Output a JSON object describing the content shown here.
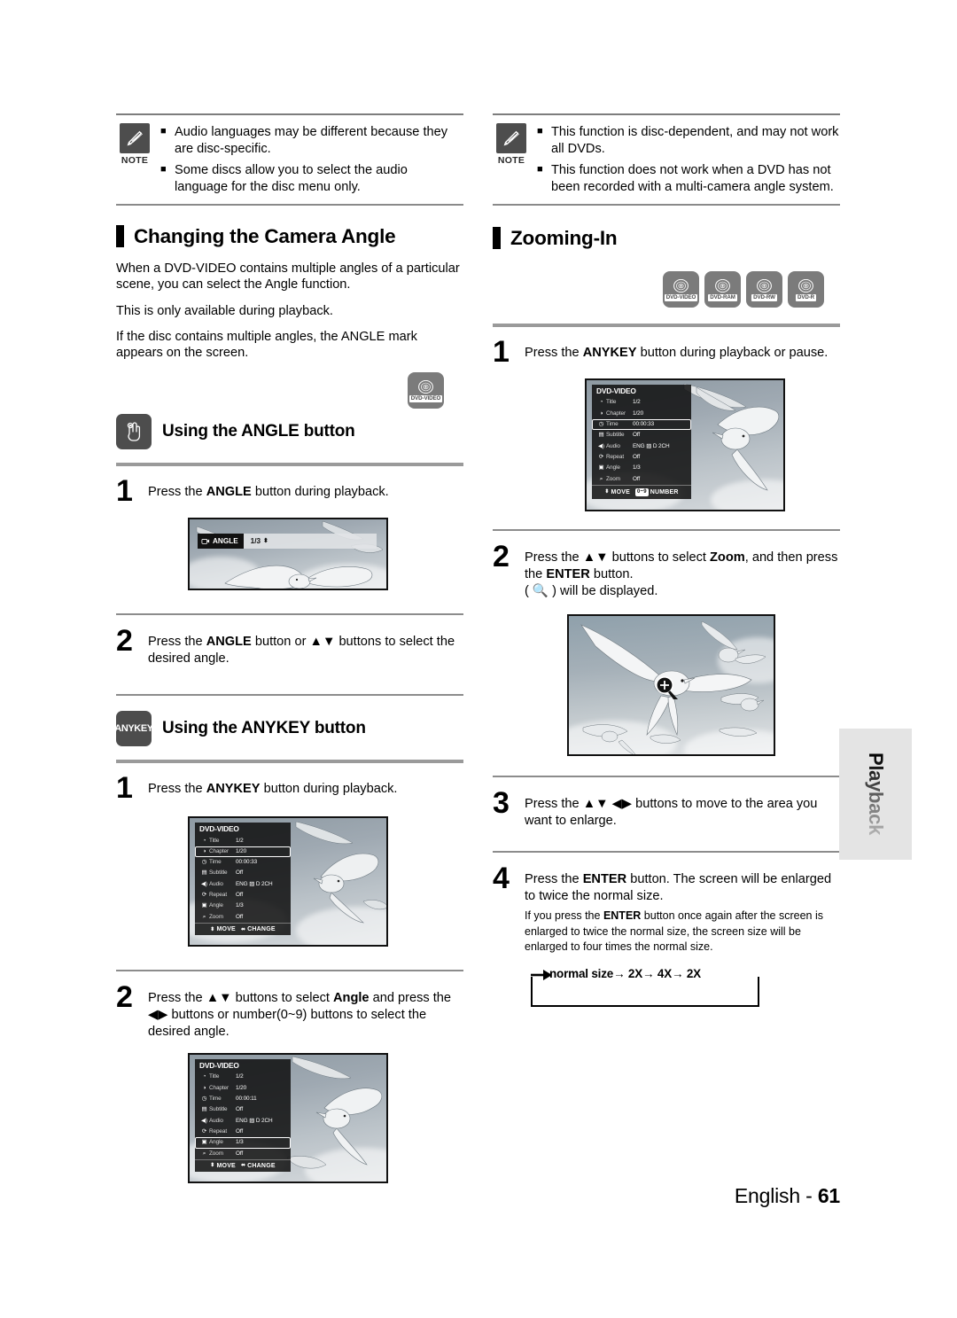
{
  "page": {
    "footer_label": "English",
    "footer_sep": "-",
    "footer_page": "61",
    "side_tab": "Playback"
  },
  "notes": {
    "left": {
      "badge_caption": "NOTE",
      "items": [
        "Audio languages may be different because they are disc-specific.",
        "Some discs allow you to select the audio language for the disc menu only."
      ]
    },
    "right": {
      "badge_caption": "NOTE",
      "items": [
        "This function is disc-dependent, and may not work all DVDs.",
        "This function does not work when a DVD has not been recorded with a multi-camera angle system."
      ]
    }
  },
  "left_column": {
    "section_title": "Changing the Camera Angle",
    "paragraphs": [
      "When a DVD-VIDEO contains multiple angles of a particular scene, you can select the Angle function.",
      "This is only available during playback.",
      "If the disc contains multiple angles, the ANGLE mark appears on the screen."
    ],
    "disc_badge": "DVD-VIDEO",
    "angle_section": {
      "icon_name": "hand-press-icon",
      "title": "Using the ANGLE button",
      "steps": [
        {
          "num": "1",
          "text_pre": "Press the ",
          "bold": "ANGLE",
          "text_post": " button during playback."
        },
        {
          "num": "2",
          "text_pre": "Press the ",
          "bold": "ANGLE",
          "text_post": " button or ▲▼ buttons to select the desired angle."
        }
      ]
    },
    "anykey_section": {
      "icon_label": "ANYKEY",
      "title": "Using the ANYKEY button",
      "steps": [
        {
          "num": "1",
          "text_pre": "Press the ",
          "bold": "ANYKEY",
          "text_post": " button during playback."
        },
        {
          "num": "2",
          "text_pre": "Press the ▲▼ buttons to select ",
          "bold": "Angle",
          "text_post": " and press the ◀▶ buttons or number(0~9) buttons to select the desired angle."
        }
      ]
    },
    "angle_overlay": {
      "label": "ANGLE",
      "value": "1/3"
    },
    "osd_1": {
      "title": "DVD-VIDEO",
      "selected": "Chapter",
      "rows": [
        {
          "label": "Title",
          "value": "1/2"
        },
        {
          "label": "Chapter",
          "value": "1/20"
        },
        {
          "label": "Time",
          "value": "00:00:33"
        },
        {
          "label": "Subtitle",
          "value": "Off"
        },
        {
          "label": "Audio",
          "value": "ENG ▨ D 2CH"
        },
        {
          "label": "Repeat",
          "value": "Off"
        },
        {
          "label": "Angle",
          "value": "1/3"
        },
        {
          "label": "Zoom",
          "value": "Off"
        }
      ],
      "foot_move": "MOVE",
      "foot_action": "CHANGE"
    },
    "osd_2": {
      "title": "DVD-VIDEO",
      "selected": "Angle",
      "rows": [
        {
          "label": "Title",
          "value": "1/2"
        },
        {
          "label": "Chapter",
          "value": "1/20"
        },
        {
          "label": "Time",
          "value": "00:00:11"
        },
        {
          "label": "Subtitle",
          "value": "Off"
        },
        {
          "label": "Audio",
          "value": "ENG ▨ D 2CH"
        },
        {
          "label": "Repeat",
          "value": "Off"
        },
        {
          "label": "Angle",
          "value": "1/3"
        },
        {
          "label": "Zoom",
          "value": "Off"
        }
      ],
      "foot_move": "MOVE",
      "foot_action": "CHANGE"
    }
  },
  "right_column": {
    "section_title": "Zooming-In",
    "disc_badges": [
      "DVD-VIDEO",
      "DVD-RAM",
      "DVD-RW",
      "DVD-R"
    ],
    "steps": [
      {
        "num": "1",
        "text_pre": "Press the ",
        "bold": "ANYKEY",
        "text_post": " button during playback or pause."
      },
      {
        "num": "2",
        "text_pre": "Press the ▲▼ buttons to select ",
        "bold": "Zoom",
        "text_post": ", and then press the ",
        "bold2": "ENTER",
        "text_post2": " button.",
        "extra": "( 🔍 ) will be displayed."
      },
      {
        "num": "3",
        "text_pre": "Press the ▲▼ ◀▶ buttons to move to the area you want to enlarge.",
        "bold": "",
        "text_post": ""
      },
      {
        "num": "4",
        "text_pre": "Press the ",
        "bold": "ENTER",
        "text_post": " button. The screen will be enlarged to twice the normal size.",
        "sub_pre": "If you press the ",
        "sub_bold": "ENTER",
        "sub_post": " button once again after the screen is  enlarged to twice the normal size, the screen size will be enlarged to four times the normal size."
      }
    ],
    "osd": {
      "title": "DVD-VIDEO",
      "selected": "Time",
      "rows": [
        {
          "label": "Title",
          "value": "1/2"
        },
        {
          "label": "Chapter",
          "value": "1/20"
        },
        {
          "label": "Time",
          "value": "00:00:33"
        },
        {
          "label": "Subtitle",
          "value": "Off"
        },
        {
          "label": "Audio",
          "value": "ENG ▨ D 2CH"
        },
        {
          "label": "Repeat",
          "value": "Off"
        },
        {
          "label": "Angle",
          "value": "1/3"
        },
        {
          "label": "Zoom",
          "value": "Off"
        }
      ],
      "foot_move": "MOVE",
      "foot_chip": "0~9",
      "foot_action": "NUMBER"
    },
    "zoom_cycle": "normal size→ 2X→ 4X→ 2X"
  }
}
